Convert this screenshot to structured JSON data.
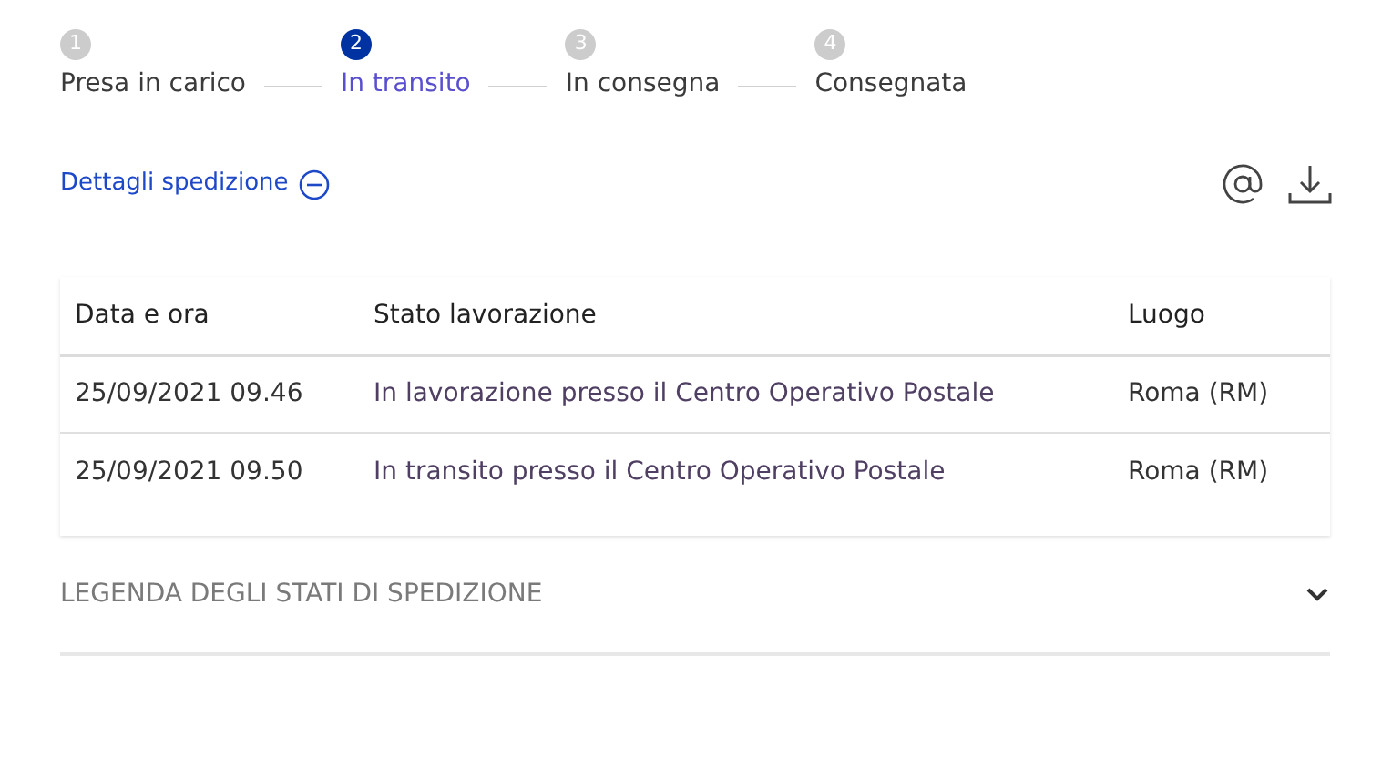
{
  "steps": [
    {
      "number": "1",
      "label": "Presa in carico",
      "selected": false
    },
    {
      "number": "2",
      "label": "In transito",
      "selected": true
    },
    {
      "number": "3",
      "label": "In consegna",
      "selected": false
    },
    {
      "number": "4",
      "label": "Consegnata",
      "selected": false
    }
  ],
  "details": {
    "label": "Dettagli spedizione",
    "expanded": true
  },
  "table": {
    "columns": [
      "Data e ora",
      "Stato lavorazione",
      "Luogo"
    ],
    "rows": [
      [
        "25/09/2021 09.46",
        "In lavorazione presso il Centro Operativo Postale",
        "Roma (RM)"
      ],
      [
        "25/09/2021 09.50",
        "In transito presso il Centro Operativo Postale",
        "Roma (RM)"
      ]
    ]
  },
  "legend": {
    "label": "LEGENDA DEGLI STATI DI SPEDIZIONE",
    "expanded": false
  }
}
